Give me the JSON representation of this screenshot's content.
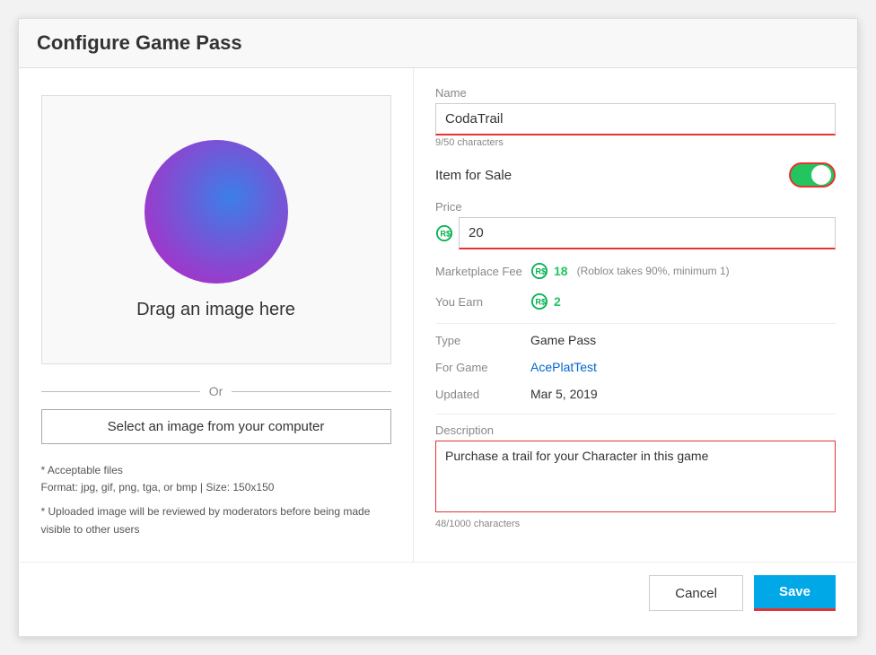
{
  "header": {
    "title": "Configure Game Pass"
  },
  "left": {
    "drag_text": "Drag an image here",
    "or_text": "Or",
    "select_button": "Select an image from your computer",
    "file_info_line1": "* Acceptable files",
    "file_info_line2": "Format: jpg, gif, png, tga, or bmp | Size: 150x150",
    "file_info_line3": "* Uploaded image will be reviewed by moderators before being made visible to other users"
  },
  "right": {
    "name_label": "Name",
    "name_value": "CodaTrail",
    "name_char_count": "9/50 characters",
    "item_for_sale_label": "Item for Sale",
    "price_label": "Price",
    "price_value": "20",
    "marketplace_fee_label": "Marketplace Fee",
    "marketplace_fee_value": "18",
    "marketplace_fee_note": "(Roblox takes 90%, minimum 1)",
    "you_earn_label": "You Earn",
    "you_earn_value": "2",
    "type_label": "Type",
    "type_value": "Game Pass",
    "for_game_label": "For Game",
    "for_game_value": "AcePlatTest",
    "updated_label": "Updated",
    "updated_value": "Mar 5, 2019",
    "description_label": "Description",
    "description_value": "Purchase a trail for your Character in this game",
    "description_char_count": "48/1000 characters"
  },
  "footer": {
    "cancel_label": "Cancel",
    "save_label": "Save"
  }
}
